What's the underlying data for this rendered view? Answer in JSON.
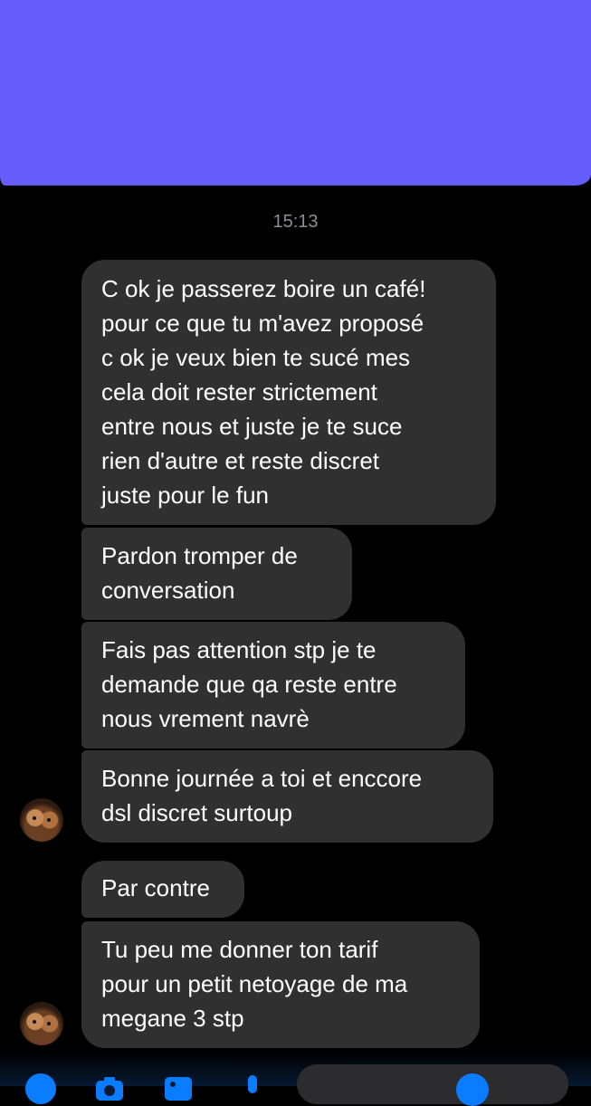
{
  "timestamp": "15:13",
  "messages": [
    {
      "text": "C  ok je passerez boire un café!\npour ce que tu m'avez proposé\nc ok je veux bien te sucé mes\ncela doit rester strictement\nentre nous et juste je te suce\nrien d'autre et reste discret\njuste pour le fun"
    },
    {
      "text": "Pardon tromper de\nconversation"
    },
    {
      "text": "Fais pas attention stp je te\ndemande que qa reste entre\nnous vrement navrè"
    },
    {
      "text": "Bonne journée a toi et enccore\ndsl discret surtoup"
    },
    {
      "text": "Par contre"
    },
    {
      "text": "Tu peu me donner ton tarif\npour un petit netoyage de ma\nmegane 3 stp"
    }
  ],
  "icons": {
    "avatar": "contact-avatar",
    "plus": "plus-icon",
    "camera": "camera-icon",
    "photo": "photo-icon",
    "mic": "microphone-icon",
    "emoji": "emoji-icon"
  },
  "colors": {
    "redaction": "#665cfb",
    "bubble": "#303030",
    "accent": "#0a7cff",
    "timestamp": "#8e8e93"
  }
}
